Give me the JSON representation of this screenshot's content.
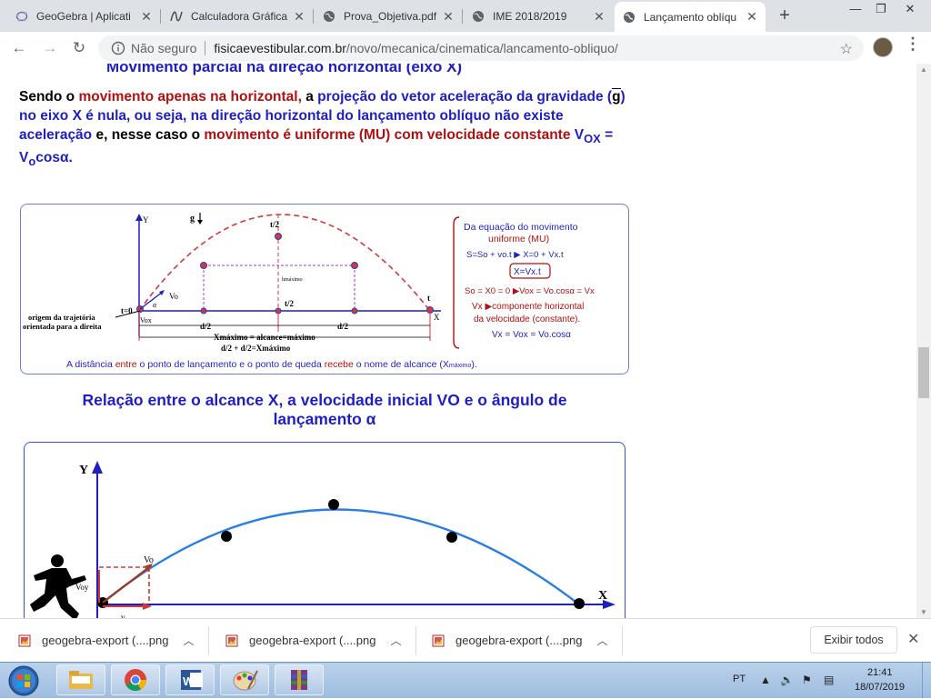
{
  "browser": {
    "tabs": [
      {
        "title": "GeoGebra | Aplicati",
        "icon": "geogebra-icon"
      },
      {
        "title": "Calculadora Gráfica",
        "icon": "graph-icon"
      },
      {
        "title": "Prova_Objetiva.pdf",
        "icon": "globe-icon"
      },
      {
        "title": "IME 2018/2019",
        "icon": "globe-icon"
      },
      {
        "title": "Lançamento oblíqu",
        "icon": "globe-icon"
      }
    ],
    "new_tab": "+",
    "window_controls": {
      "minimize": "—",
      "restore": "❐",
      "close": "✕"
    },
    "nav": {
      "back": "←",
      "forward": "→",
      "reload": "↻"
    },
    "address": {
      "security": "Não seguro",
      "domain": "fisicaevestibular.com.br",
      "path": "/novo/mecanica/cinematica/lancamento-obliquo/"
    },
    "star": "☆",
    "menu": "⋮"
  },
  "page": {
    "heading_top": "Movimento parcial na direção horizontal (eixo X)",
    "para": {
      "s1": "Sendo o ",
      "s2": "movimento apenas na horizontal,",
      "s3": " a ",
      "s4": "projeção do vetor aceleração da gravidade (",
      "s5": "g",
      "s6": ") no eixo X é nula, ou seja, na direção horizontal do lançamento oblíquo não existe aceleração",
      "s7": " e, nesse caso o ",
      "s8": "movimento é uniforme (MU) com velocidade constante",
      "s9": " V",
      "s10": "OX",
      "s11": " = V",
      "s12": "o",
      "s13": "cosα."
    },
    "fig1": {
      "axis_y": "Y",
      "axis_x": "X",
      "g_label": "g",
      "t0": "t=0",
      "t_half": "t/2",
      "t_half_bottom": "t/2",
      "t_end": "t",
      "alpha": "α",
      "vo": "Vo",
      "vox": "Vox",
      "hmax": "hmáximo",
      "origin_line1": "origem da trajetória",
      "origin_line2": "orientada para a direita",
      "d2_left": "d/2",
      "d2_right": "d/2",
      "xmax_eq": "Xmáximo = alcance=máximo",
      "d_sum": "d/2 + d/2=Xmáximo",
      "caption_part1": "A distância ",
      "caption_part2": "entre",
      "caption_part3": " o ponto de lançamento e o ponto de queda ",
      "caption_part4": "recebe",
      "caption_part5": " o nome de alcance (X",
      "caption_part6": "máximo",
      "caption_part7": ").",
      "box_l1": "Da equação do movimento",
      "box_l2": "uniforme (MU)",
      "box_l3": "S=So + vo.t  ▶ X=0 + Vx.t",
      "box_l4": "X=Vx.t",
      "box_l5": "So = X0 = 0  ▶Vox = Vo.cosα = Vx",
      "box_l6": "Vx  ▶componente horizontal",
      "box_l7": "da velocidade (constante).",
      "box_l8": "Vx = Vox = Vo.cosα"
    },
    "heading2_line1": "Relação entre o alcance X, a velocidade inicial VO e o ângulo de",
    "heading2_line2": "lançamento α",
    "fig2": {
      "axis_y": "Y",
      "axis_x": "X",
      "vo_label": "Vo",
      "voy_label": "Voy",
      "vox_label": "v"
    }
  },
  "downloads": {
    "items": [
      "geogebra-export (....png",
      "geogebra-export (....png",
      "geogebra-export (....png"
    ],
    "show_all": "Exibir todos",
    "close": "✕"
  },
  "taskbar": {
    "language": "PT",
    "time": "21:41",
    "date": "18/07/2019"
  },
  "colors": {
    "blue_text": "#1f1fbf",
    "red_text": "#b01010",
    "curve_red": "#d23a3a",
    "curve_blue": "#2a7de1"
  }
}
